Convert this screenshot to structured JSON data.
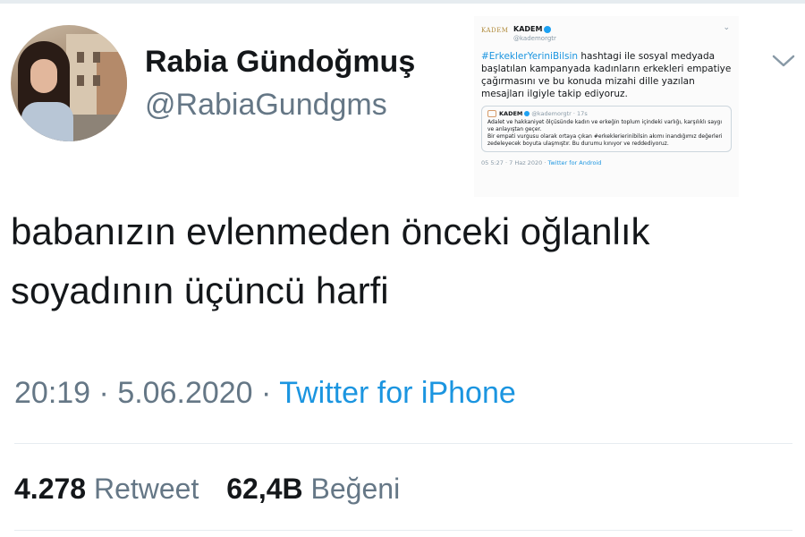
{
  "tweet": {
    "author": {
      "name": "Rabia Gündoğmuş",
      "handle": "@RabiaGundgms"
    },
    "text_line1": "babanızın evlenmeden önceki oğlanlık",
    "text_line2": "soyadının üçüncü harfi",
    "time": "20:19",
    "date": "5.06.2020",
    "separator": "·",
    "source": "Twitter for iPhone",
    "retweets": {
      "count": "4.278",
      "label": "Retweet"
    },
    "likes": {
      "count": "62,4B",
      "label": "Beğeni"
    }
  },
  "quoted_image": {
    "logo_text": "KADEM",
    "author_name": "KADEM",
    "author_handle": "@kademorgtr",
    "hashtag": "#ErkeklerYeriniBilsin",
    "text": " hashtagi ile sosyal medyada başlatılan kampanyada kadınların erkekleri empatiye çağırmasını ve bu konuda mizahi dille yazılan mesajları ilgiyle takip ediyoruz.",
    "inner": {
      "author_name": "KADEM",
      "author_handle": "@kademorgtr · 17s",
      "text1": "Adalet ve hakkaniyet ölçüsünde kadın ve erkeğin toplum içindeki varlığı, karşılıklı saygı ve anlayıştan geçer.",
      "text2": "Bir empati vurgusu olarak ortaya çıkan #erkeklerierinibilsin akımı inandığımız değerleri zedeleyecek boyuta ulaşmıştır. Bu durumu kınıyor ve reddediyoruz."
    },
    "meta_time": "05 5:27 · 7 Haz 2020 · ",
    "meta_source": "Twitter for Android"
  },
  "icons": {
    "menu": "chevron-down-icon",
    "verified": "verified-badge-icon"
  },
  "colors": {
    "link": "#1b95e0",
    "muted": "#657786",
    "text": "#14171a",
    "divider": "#e6ecf0"
  }
}
